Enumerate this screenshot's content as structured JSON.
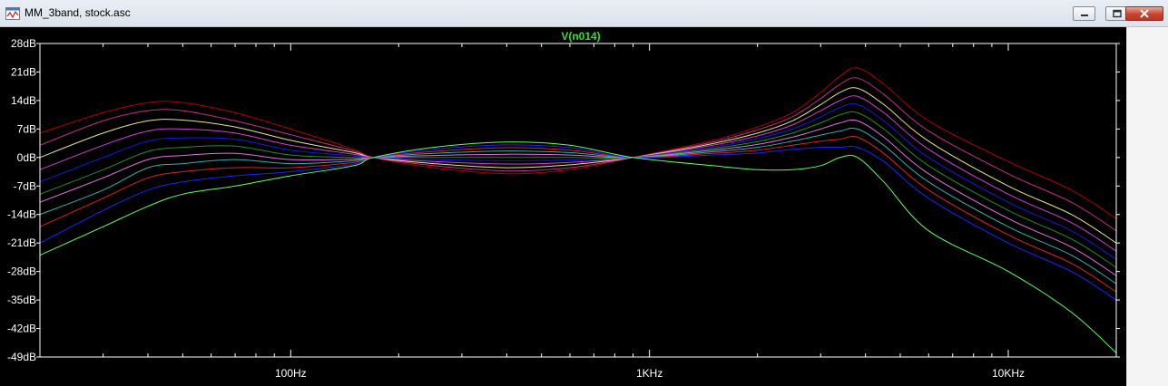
{
  "window": {
    "title": "MM_3band, stock.asc",
    "app_icon": "waveform-window-icon",
    "buttons": {
      "minimize": "minimize-icon",
      "maximize": "maximize-icon",
      "close": "close-icon"
    }
  },
  "colors": {
    "background": "#000000",
    "axis": "#ffffff",
    "tick_label": "#ffffff",
    "trace_title": "#33dd33",
    "series": [
      "#b00000",
      "#c03080",
      "#e8e880",
      "#d040d0",
      "#1818e0",
      "#209020",
      "#e070e0",
      "#30b0b0",
      "#e02020",
      "#2020ff",
      "#60ff60"
    ]
  },
  "chart_data": {
    "type": "line",
    "title": "V(n014)",
    "xscale": "log",
    "xlim": [
      20,
      20000
    ],
    "ylim": [
      -49,
      28
    ],
    "xlabel": "",
    "ylabel": "",
    "grid": false,
    "x_ticks": [
      {
        "value": 100,
        "label": "100Hz"
      },
      {
        "value": 1000,
        "label": "1KHz"
      },
      {
        "value": 10000,
        "label": "10KHz"
      }
    ],
    "y_ticks": [
      {
        "value": 28,
        "label": "28dB"
      },
      {
        "value": 21,
        "label": "21dB"
      },
      {
        "value": 14,
        "label": "14dB"
      },
      {
        "value": 7,
        "label": "7dB"
      },
      {
        "value": 0,
        "label": "0dB"
      },
      {
        "value": -7,
        "label": "-7dB"
      },
      {
        "value": -14,
        "label": "-14dB"
      },
      {
        "value": -21,
        "label": "-21dB"
      },
      {
        "value": -28,
        "label": "-28dB"
      },
      {
        "value": -35,
        "label": "-35dB"
      },
      {
        "value": -42,
        "label": "-42dB"
      },
      {
        "value": -49,
        "label": "-49dB"
      }
    ],
    "x": [
      20,
      30,
      40,
      50,
      70,
      100,
      150,
      170,
      250,
      400,
      600,
      900,
      1500,
      2000,
      2500,
      3000,
      3400,
      3800,
      4500,
      6000,
      10000,
      15000,
      20000
    ],
    "series": [
      {
        "values": [
          6,
          11,
          13.5,
          13.5,
          11,
          7,
          2,
          0,
          -2.5,
          -4,
          -3,
          0,
          4.2,
          7.5,
          11,
          16,
          20,
          22,
          18,
          9,
          -1,
          -8,
          -15
        ]
      },
      {
        "values": [
          3,
          9,
          11.5,
          11.5,
          9,
          5.6,
          1.6,
          0,
          -2,
          -3.3,
          -2.5,
          0,
          3.8,
          6.8,
          10,
          14.5,
          18,
          19.5,
          15.5,
          6.5,
          -4,
          -11,
          -18
        ]
      },
      {
        "values": [
          0,
          6,
          9,
          9.2,
          7.5,
          4.2,
          1.2,
          0,
          -1.5,
          -2.5,
          -1.8,
          0,
          3.4,
          6,
          9,
          13,
          16,
          17,
          13,
          4,
          -7,
          -14,
          -21
        ]
      },
      {
        "values": [
          -3,
          3,
          6.5,
          7,
          6,
          3,
          0.8,
          0,
          -1,
          -1.6,
          -1.2,
          0,
          3,
          5.3,
          8,
          11.5,
          14,
          15,
          11,
          2,
          -9,
          -16,
          -23
        ]
      },
      {
        "values": [
          -6,
          0,
          4,
          4.8,
          4.5,
          1.8,
          0.4,
          0,
          -0.5,
          -0.8,
          -0.6,
          0,
          2.6,
          4.6,
          7,
          10,
          12.3,
          13,
          9,
          0,
          -11,
          -18,
          -25
        ]
      },
      {
        "values": [
          -9,
          -3,
          1.5,
          2.5,
          2.8,
          0.6,
          0,
          0,
          0,
          0,
          0,
          0,
          2.2,
          3.9,
          6,
          8.5,
          10.5,
          11,
          7,
          -2,
          -13,
          -20,
          -27
        ]
      },
      {
        "values": [
          -11,
          -5,
          -0.5,
          0.5,
          1,
          -0.5,
          -0.4,
          0,
          0.5,
          0.8,
          0.6,
          0,
          1.8,
          3.2,
          5,
          7,
          8.5,
          9,
          5,
          -4,
          -15,
          -22,
          -29
        ]
      },
      {
        "values": [
          -14,
          -8,
          -2.5,
          -1.5,
          -0.5,
          -1.5,
          -0.8,
          0,
          1,
          1.6,
          1.2,
          0,
          1.4,
          2.5,
          4,
          5.5,
          6.5,
          7,
          3,
          -6,
          -17,
          -24,
          -31
        ]
      },
      {
        "values": [
          -17,
          -10,
          -5,
          -3.5,
          -2.5,
          -2.5,
          -1.2,
          0,
          1.5,
          2.4,
          1.8,
          0,
          1,
          1.8,
          3,
          4,
          4.5,
          5,
          1,
          -8,
          -19,
          -26,
          -33
        ]
      },
      {
        "values": [
          -21,
          -13,
          -8,
          -6,
          -4.5,
          -3.5,
          -1.6,
          0,
          2,
          3.1,
          2.4,
          0,
          0.6,
          1.1,
          2,
          2.5,
          2.5,
          2.5,
          -1,
          -10,
          -21,
          -28,
          -35
        ]
      },
      {
        "values": [
          -24,
          -17,
          -12,
          -9,
          -7,
          -4.5,
          -2,
          0,
          2.5,
          3.8,
          3,
          0,
          -2,
          -3,
          -3,
          -2,
          0,
          0,
          -6,
          -18,
          -28,
          -38,
          -48
        ]
      }
    ]
  }
}
